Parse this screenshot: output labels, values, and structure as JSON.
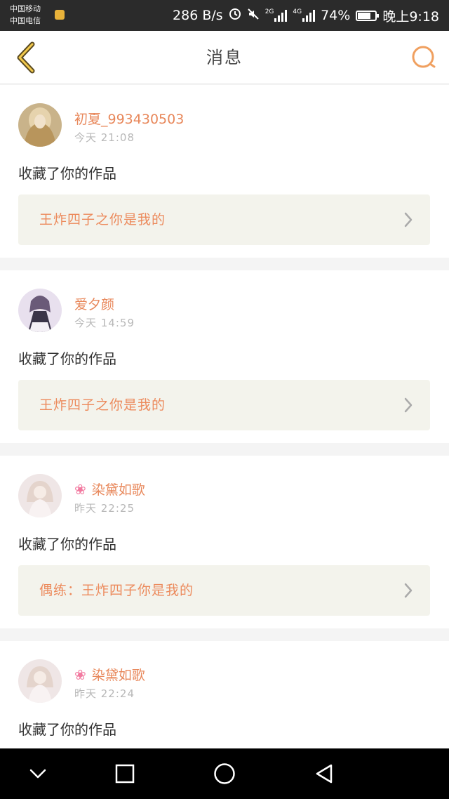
{
  "status_bar": {
    "carrier_1": "中国移动",
    "carrier_2": "中国电信",
    "net_speed": "286 B/s",
    "net_2g": "2G",
    "net_4g": "4G",
    "battery_percent": "74%",
    "battery_level": 0.74,
    "time": "晚上9:18"
  },
  "header": {
    "title": "消息",
    "back_icon": "chevron-left-icon",
    "search_icon": "search-icon"
  },
  "colors": {
    "accent": "#e8875a",
    "work_bg": "#f3f3ec",
    "page_bg": "#f4f4f4"
  },
  "messages": [
    {
      "username": "初夏_993430503",
      "time": "今天 21:08",
      "action": "收藏了你的作品",
      "work": "王炸四子之你是我的",
      "has_flower": false
    },
    {
      "username": "爱夕颜",
      "time": "今天 14:59",
      "action": "收藏了你的作品",
      "work": "王炸四子之你是我的",
      "has_flower": false
    },
    {
      "username": "染黛如歌",
      "time": "昨天 22:25",
      "action": "收藏了你的作品",
      "work": "偶练：王炸四子你是我的",
      "has_flower": true
    },
    {
      "username": "染黛如歌",
      "time": "昨天 22:24",
      "action": "收藏了你的作品",
      "work": "",
      "has_flower": true
    }
  ]
}
